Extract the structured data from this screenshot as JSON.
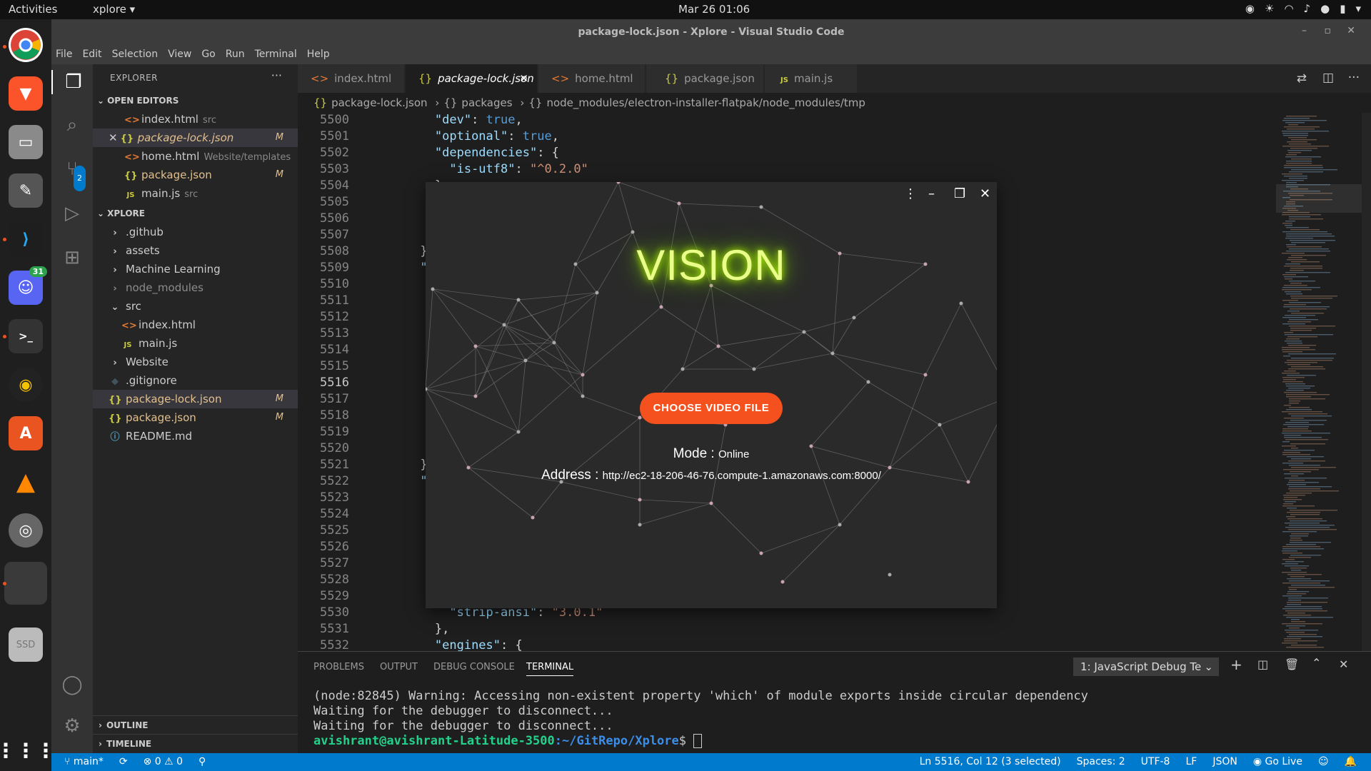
{
  "topbar": {
    "activities": "Activities",
    "app": "xplore ▾",
    "clock": "Mar 26  01:06"
  },
  "dock": {
    "discord_badge": "31",
    "ssd_label": "SSD"
  },
  "window": {
    "title": "package-lock.json - Xplore - Visual Studio Code"
  },
  "menu": [
    "File",
    "Edit",
    "Selection",
    "View",
    "Go",
    "Run",
    "Terminal",
    "Help"
  ],
  "activity": {
    "scm_badge": "2"
  },
  "explorer": {
    "title": "EXPLORER",
    "more": "···",
    "open_editors_label": "OPEN EDITORS",
    "open_editors": [
      {
        "icon": "<>",
        "name": "index.html",
        "hint": "src",
        "mod": ""
      },
      {
        "icon": "{}",
        "name": "package-lock.json",
        "hint": "",
        "mod": "M"
      },
      {
        "icon": "<>",
        "name": "home.html",
        "hint": "Website/templates",
        "mod": ""
      },
      {
        "icon": "{}",
        "name": "package.json",
        "hint": "",
        "mod": "M"
      },
      {
        "icon": "JS",
        "name": "main.js",
        "hint": "src",
        "mod": ""
      }
    ],
    "project_label": "XPLORE",
    "tree": [
      {
        "kind": ">",
        "name": ".github"
      },
      {
        "kind": ">",
        "name": "assets"
      },
      {
        "kind": ">",
        "name": "Machine Learning"
      },
      {
        "kind": ">",
        "name": "node_modules"
      },
      {
        "kind": "v",
        "name": "src"
      },
      {
        "kind": "<>",
        "name": "index.html"
      },
      {
        "kind": "JS",
        "name": "main.js"
      },
      {
        "kind": ">",
        "name": "Website"
      },
      {
        "kind": "◆",
        "name": ".gitignore"
      },
      {
        "kind": "{}",
        "name": "package-lock.json",
        "mod": "M"
      },
      {
        "kind": "{}",
        "name": "package.json",
        "mod": "M"
      },
      {
        "kind": "ⓘ",
        "name": "README.md"
      }
    ],
    "outline": "OUTLINE",
    "timeline": "TIMELINE"
  },
  "tabs": [
    {
      "icon": "<>",
      "label": "index.html"
    },
    {
      "icon": "{}",
      "label": "package-lock.json"
    },
    {
      "icon": "<>",
      "label": "home.html"
    },
    {
      "icon": "{}",
      "label": "package.json"
    },
    {
      "icon": "JS",
      "label": "main.js"
    }
  ],
  "breadcrumb": {
    "file": "package-lock.json",
    "seg1": "packages",
    "seg2": "node_modules/electron-installer-flatpak/node_modules/tmp"
  },
  "editor": {
    "lines": [
      "5500",
      "5501",
      "5502",
      "5503",
      "5504",
      "5505",
      "5506",
      "5507",
      "5508",
      "5509",
      "5510",
      "5511",
      "5512",
      "5513",
      "5514",
      "5515",
      "5516",
      "5517",
      "5518",
      "5519",
      "5520",
      "5521",
      "5522",
      "5523",
      "5524",
      "5525",
      "5526",
      "5527",
      "5528",
      "5529",
      "5530",
      "5531",
      "5532"
    ],
    "code": {
      "l5500": "\"dev\"",
      "l5500v": "true",
      "l5501": "\"optional\"",
      "l5501v": "true",
      "l5502": "\"dependencies\"",
      "l5503": "\"is-utf8\"",
      "l5503v": "\"^0.2.0\"",
      "l5530": "\"strip-ansi\"",
      "l5530v": "\"3.0.1\"",
      "l5532": "\"engines\"",
      "frag_e": "\"e",
      "frag_noc": "\"noc",
      "frag_q": "\""
    }
  },
  "panel": {
    "tabs": [
      "PROBLEMS",
      "OUTPUT",
      "DEBUG CONSOLE",
      "TERMINAL"
    ],
    "terminal_select": "1: JavaScript Debug Te",
    "lines": [
      "(node:82845) Warning: Accessing non-existent property 'which' of module exports inside circular dependency",
      "Waiting for the debugger to disconnect...",
      "Waiting for the debugger to disconnect..."
    ],
    "prompt_user": "avishrant@avishrant-Latitude-3500",
    "prompt_path": ":~/GitRepo/Xplore",
    "prompt_end": "$ "
  },
  "status": {
    "branch": "main*",
    "errors": "⊗ 0 ⚠ 0",
    "position": "Ln 5516, Col 12 (3 selected)",
    "spaces": "Spaces: 2",
    "encoding": "UTF-8",
    "eol": "LF",
    "lang": "JSON",
    "golive": "Go Live"
  },
  "vision": {
    "title": "VISION",
    "button": "CHOOSE VIDEO FILE",
    "mode_label": "Mode : ",
    "mode_value": "Online",
    "address_label": "Address : ",
    "address_value": "http://ec2-18-206-46-76.compute-1.amazonaws.com:8000/"
  },
  "colors": {
    "accent": "#007acc",
    "vision_button": "#f4511e",
    "vision_glow": "#b9ff00"
  }
}
